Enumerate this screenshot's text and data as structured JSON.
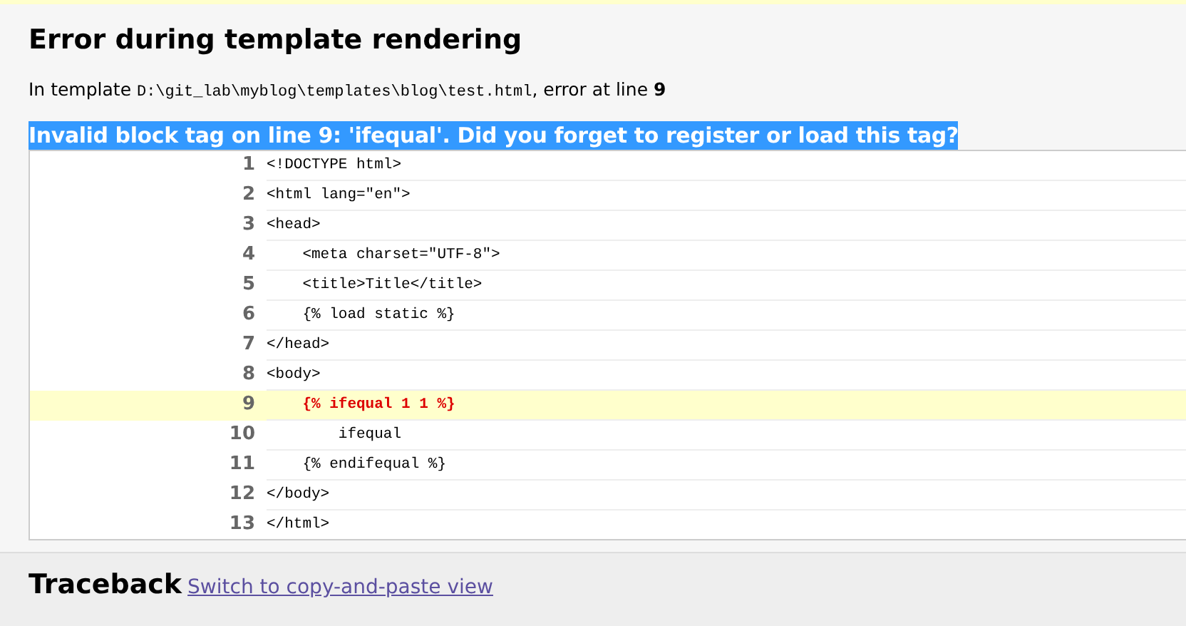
{
  "title": "Error during template rendering",
  "info": {
    "prefix": "In template",
    "path": "D:\\git_lab\\myblog\\templates\\blog\\test.html",
    "suffix": ", error at line **9**"
  },
  "message": {
    "text": "Invalid block tag on line 9: 'ifequal'. Did you forget to register or load this tag?",
    "selected": true
  },
  "source_lines": [
    {
      "number": "1",
      "code": "<!DOCTYPE html>",
      "error": false
    },
    {
      "number": "2",
      "code": "<html lang=\"en\">",
      "error": false
    },
    {
      "number": "3",
      "code": "<head>",
      "error": false
    },
    {
      "number": "4",
      "code": "    <meta charset=\"UTF-8\">",
      "error": false
    },
    {
      "number": "5",
      "code": "    <title>Title</title>",
      "error": false
    },
    {
      "number": "6",
      "code": "    {% load static %}",
      "error": false
    },
    {
      "number": "7",
      "code": "</head>",
      "error": false
    },
    {
      "number": "8",
      "code": "<body>",
      "error": false
    },
    {
      "number": "9",
      "code": "    {% ifequal 1 1 %}",
      "error": true
    },
    {
      "number": "10",
      "code": "        ifequal",
      "error": false
    },
    {
      "number": "11",
      "code": "    {% endifequal %}",
      "error": false
    },
    {
      "number": "12",
      "code": "</body>",
      "error": false
    },
    {
      "number": "13",
      "code": "</html>",
      "error": false
    }
  ],
  "traceback": {
    "title": "Traceback",
    "link": "Switch to copy-and-paste view"
  }
}
